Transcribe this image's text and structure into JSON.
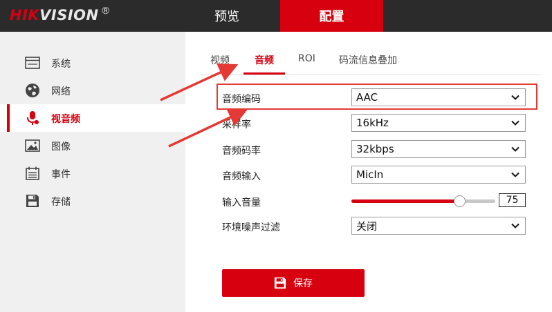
{
  "header": {
    "logo_hik": "HIK",
    "logo_vision": "VISION",
    "logo_reg": "®",
    "nav": [
      {
        "label": "预览"
      },
      {
        "label": "配置"
      }
    ],
    "active_nav": "配置"
  },
  "sidebar": {
    "items": [
      {
        "label": "系统",
        "icon": "window-icon"
      },
      {
        "label": "网络",
        "icon": "globe-icon"
      },
      {
        "label": "视音频",
        "icon": "microphone-icon"
      },
      {
        "label": "图像",
        "icon": "image-icon"
      },
      {
        "label": "事件",
        "icon": "calendar-icon"
      },
      {
        "label": "存储",
        "icon": "floppy-disk-icon"
      }
    ],
    "active": "视音频"
  },
  "tabs": {
    "items": [
      {
        "label": "视频"
      },
      {
        "label": "音频"
      },
      {
        "label": "ROI"
      },
      {
        "label": "码流信息叠加"
      }
    ],
    "active": "音频"
  },
  "form": {
    "audio_encoding": {
      "label": "音频编码",
      "value": "AAC"
    },
    "sample_rate": {
      "label": "采样率",
      "value": "16kHz"
    },
    "bitrate": {
      "label": "音频码率",
      "value": "32kbps"
    },
    "audio_input": {
      "label": "音频输入",
      "value": "MicIn"
    },
    "input_volume": {
      "label": "输入音量",
      "value": "75",
      "level": 75,
      "max": 100
    },
    "noise_filter": {
      "label": "环境噪声过滤",
      "value": "关闭"
    }
  },
  "save_button": {
    "label": "保存",
    "icon": "floppy-disk-icon"
  },
  "colors": {
    "accent": "#d7000f",
    "header_bg": "#2b2b2b",
    "sidebar_bg": "#f0f0f0",
    "annotation": "#e53935"
  }
}
